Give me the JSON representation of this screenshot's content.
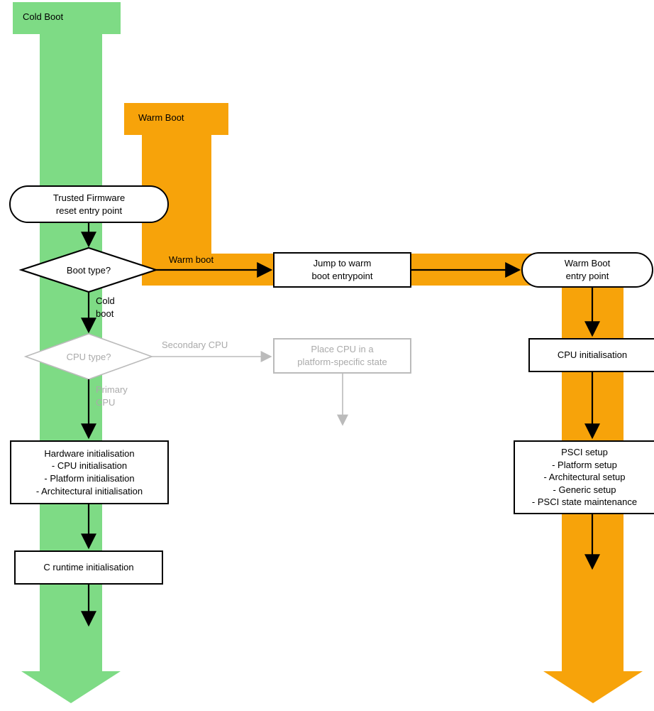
{
  "coldBootBanner": "Cold Boot",
  "warmBootBanner": "Warm Boot",
  "resetEntry": "Trusted Firmware\nreset entry point",
  "bootTypeQ": "Boot type?",
  "warmBootEdge": "Warm boot",
  "coldBootEdge": "Cold\nboot",
  "jumpWarm": "Jump to warm\nboot entrypoint",
  "warmEntry": "Warm Boot\nentry point",
  "cpuTypeQ": "CPU type?",
  "secondaryCpuEdge": "Secondary CPU",
  "primaryCpuEdge": "Primary\nCPU",
  "placeCpu": "Place CPU in a\nplatform-specific state",
  "hwInit": "Hardware initialisation\n- CPU initialisation\n- Platform initialisation\n- Architectural initialisation",
  "cRuntime": "C runtime initialisation",
  "cpuInit": "CPU initialisation",
  "psci": "PSCI setup\n- Platform setup\n- Architectural setup\n- Generic setup\n- PSCI state maintenance"
}
